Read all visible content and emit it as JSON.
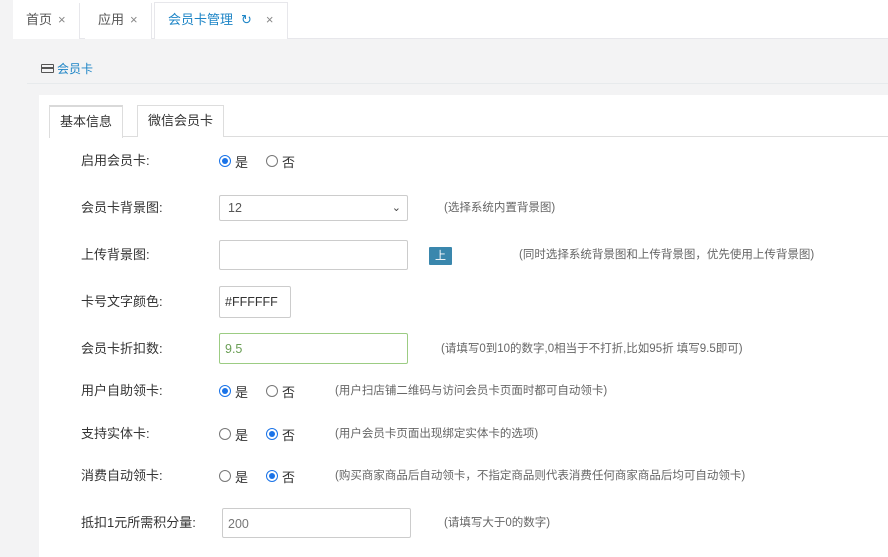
{
  "tabs": [
    {
      "label": "首页",
      "close": "×"
    },
    {
      "label": "应用",
      "close": "×"
    },
    {
      "label": "会员卡管理",
      "refresh": "↻",
      "close": "×"
    }
  ],
  "breadcrumb": {
    "label": "会员卡",
    "icon": "credit-card-icon"
  },
  "form_tabs": [
    "基本信息",
    "微信会员卡"
  ],
  "form": {
    "enable": {
      "label": "启用会员卡:",
      "options": [
        "是",
        "否"
      ],
      "selected": "是"
    },
    "background": {
      "label": "会员卡背景图:",
      "value": "12",
      "hint": "(选择系统内置背景图)"
    },
    "upload": {
      "label": "上传背景图:",
      "value": "",
      "button": "上传图片",
      "hint": "(同时选择系统背景图和上传背景图，优先使用上传背景图)"
    },
    "text_color": {
      "label": "卡号文字颜色:",
      "value": "#FFFFFF"
    },
    "discount": {
      "label": "会员卡折扣数:",
      "value": "9.5",
      "hint": "(请填写0到10的数字,0相当于不打折,比如95折 填写9.5即可)"
    },
    "self_claim": {
      "label": "用户自助领卡:",
      "options": [
        "是",
        "否"
      ],
      "selected": "是",
      "hint": "(用户扫店铺二维码与访问会员卡页面时都可自动领卡)"
    },
    "physical": {
      "label": "支持实体卡:",
      "options": [
        "是",
        "否"
      ],
      "selected": "否",
      "hint": "(用户会员卡页面出现绑定实体卡的选项)"
    },
    "auto_claim": {
      "label": "消费自动领卡:",
      "options": [
        "是",
        "否"
      ],
      "selected": "否",
      "hint": "(购买商家商品后自动领卡，不指定商品则代表消费任何商家商品后均可自动领卡)"
    },
    "points": {
      "label": "抵扣1元所需积分量:",
      "value": "200",
      "hint": "(请填写大于0的数字)"
    }
  },
  "colors": {
    "accent": "#1c84c6",
    "radio_checked": "#1a73e8",
    "upload_button": "#3a87ad",
    "valid_border": "#9ccc83"
  }
}
